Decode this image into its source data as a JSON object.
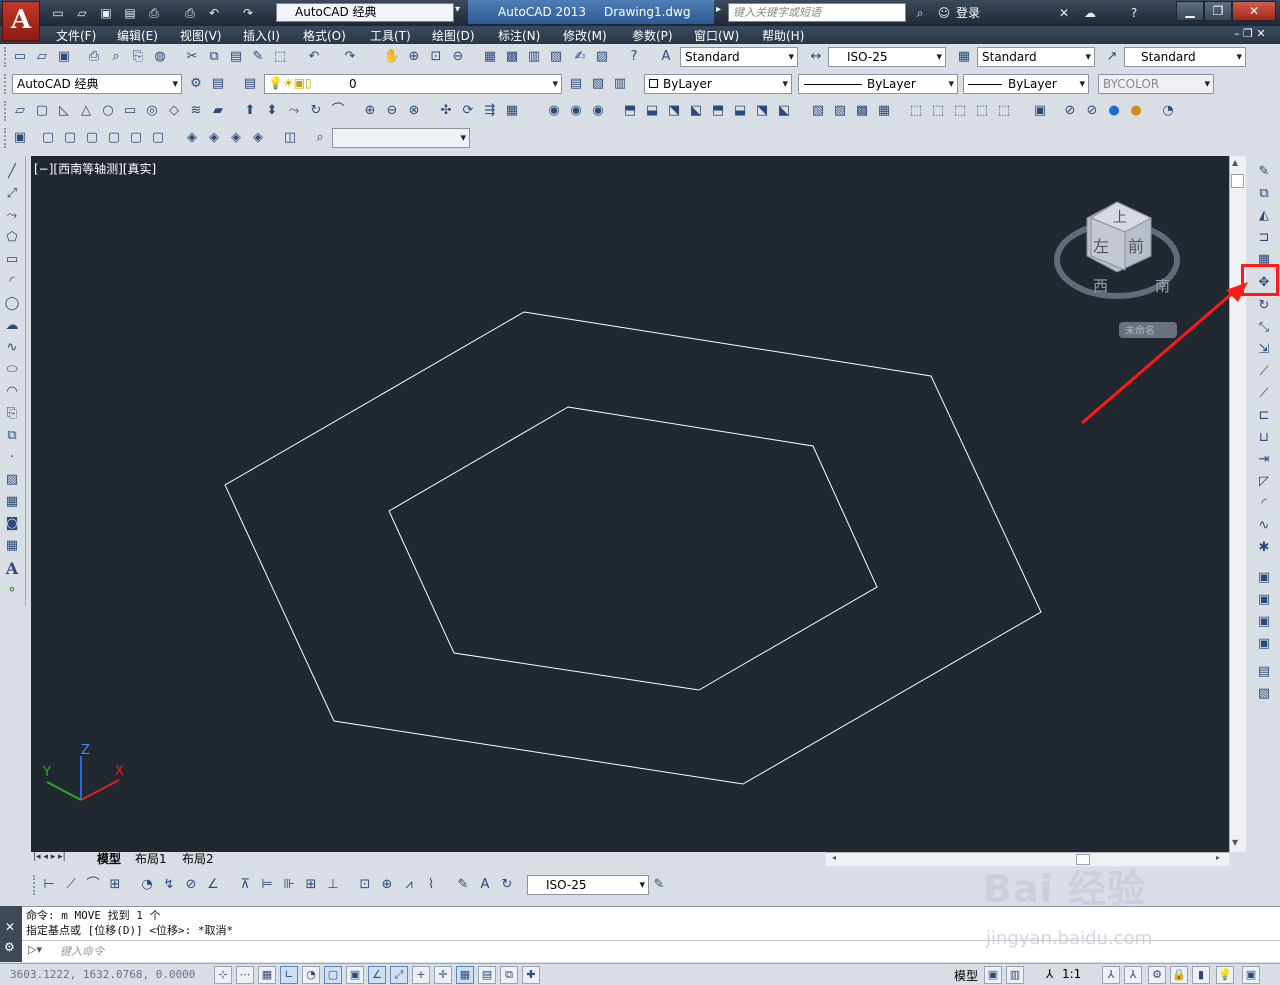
{
  "app": {
    "logo_letter": "A",
    "workspace": "AutoCAD 经典",
    "title_app": "AutoCAD 2013",
    "title_doc": "Drawing1.dwg",
    "search_placeholder": "键入关键字或短语",
    "login": "登录"
  },
  "menu": [
    "文件(F)",
    "编辑(E)",
    "视图(V)",
    "插入(I)",
    "格式(O)",
    "工具(T)",
    "绘图(D)",
    "标注(N)",
    "修改(M)",
    "参数(P)",
    "窗口(W)",
    "帮助(H)"
  ],
  "styles_toolbar": {
    "text_style": "Standard",
    "dim_style": "ISO-25",
    "table_style": "Standard",
    "mleader_style": "Standard"
  },
  "workspace_toolbar": {
    "workspace": "AutoCAD 经典"
  },
  "layers": {
    "current_layer": "0"
  },
  "properties": {
    "color": "ByLayer",
    "linetype": "ByLayer",
    "lineweight": "ByLayer",
    "plotstyle": "BYCOLOR"
  },
  "viewport": {
    "label": "[−][西南等轴测][真实]",
    "bg_color": "#212830",
    "viewcube": {
      "top": "上",
      "left": "左",
      "front": "前",
      "compass_w": "西",
      "compass_s": "南",
      "ucs_name": "未命名"
    },
    "ucs_axes": {
      "x": "X",
      "y": "Y",
      "z": "Z"
    }
  },
  "layout_tabs": [
    "模型",
    "布局1",
    "布局2"
  ],
  "dim_toolbar": {
    "dim_style": "ISO-25"
  },
  "command": {
    "history": [
      "命令: m MOVE 找到 1 个",
      "指定基点或 [位移(D)] <位移>:  *取消*"
    ],
    "prompt_placeholder": "键入命令"
  },
  "status": {
    "coords": "3603.1222,  1632.0768,  0.0000",
    "model_label": "模型",
    "annotation_scale": "1:1"
  },
  "annotation": {
    "highlight_color": "#ff1a1a",
    "target": "move-tool"
  },
  "watermark": {
    "brand": "Bai 经验",
    "url": "jingyan.baidu.com"
  }
}
